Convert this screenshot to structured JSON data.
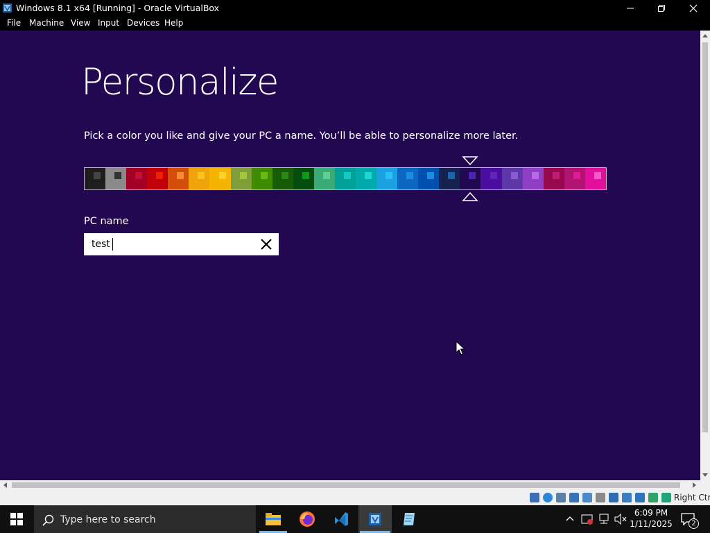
{
  "window": {
    "title": "Windows 8.1 x64 [Running] - Oracle VirtualBox"
  },
  "menu": [
    "File",
    "Machine",
    "View",
    "Input",
    "Devices",
    "Help"
  ],
  "setup": {
    "heading": "Personalize",
    "description": "Pick a color you like and give your PC a name. You’ll be able to personalize more later.",
    "pc_name_label": "PC name",
    "pc_name_value": "test"
  },
  "palette": {
    "selected_index": 18,
    "swatches": [
      {
        "bg": "#1e1e1e",
        "accent": "#444444"
      },
      {
        "bg": "#8a8a8a",
        "accent": "#333333"
      },
      {
        "bg": "#a20025",
        "accent": "#c41133"
      },
      {
        "bg": "#c2000c",
        "accent": "#ee2200"
      },
      {
        "bg": "#d24e0a",
        "accent": "#f58a35"
      },
      {
        "bg": "#f0a30a",
        "accent": "#f7c51b"
      },
      {
        "bg": "#f4b400",
        "accent": "#fed22f"
      },
      {
        "bg": "#7d9e38",
        "accent": "#a5c63b"
      },
      {
        "bg": "#3e8c00",
        "accent": "#6aba10"
      },
      {
        "bg": "#165b07",
        "accent": "#2a8a15"
      },
      {
        "bg": "#064e0f",
        "accent": "#0f9a1c"
      },
      {
        "bg": "#3aab76",
        "accent": "#5fcf8f"
      },
      {
        "bg": "#009f98",
        "accent": "#14c9c4"
      },
      {
        "bg": "#00aaaa",
        "accent": "#1bd8d0"
      },
      {
        "bg": "#1ba1e2",
        "accent": "#28c0f5"
      },
      {
        "bg": "#0f66c0",
        "accent": "#1a8ee6"
      },
      {
        "bg": "#0050b0",
        "accent": "#1c8ce3"
      },
      {
        "bg": "#15214f",
        "accent": "#1a63ad"
      },
      {
        "bg": "#220850",
        "accent": "#4824b0"
      },
      {
        "bg": "#4b0da0",
        "accent": "#6422b8"
      },
      {
        "bg": "#5d38a6",
        "accent": "#8a5ad6"
      },
      {
        "bg": "#8e3fc3",
        "accent": "#b56ae5"
      },
      {
        "bg": "#95094f",
        "accent": "#c41b78"
      },
      {
        "bg": "#b01470",
        "accent": "#e2199a"
      },
      {
        "bg": "#e0109c",
        "accent": "#f55dc6"
      }
    ]
  },
  "statusbar": {
    "host_key": "Right Ctrl"
  },
  "taskbar": {
    "search_placeholder": "Type here to search",
    "time": "6:09 PM",
    "date": "1/11/2025",
    "notification_count": "2"
  },
  "colors": {
    "guest_bg": "#220850",
    "accent_selector": "#ffffff"
  }
}
